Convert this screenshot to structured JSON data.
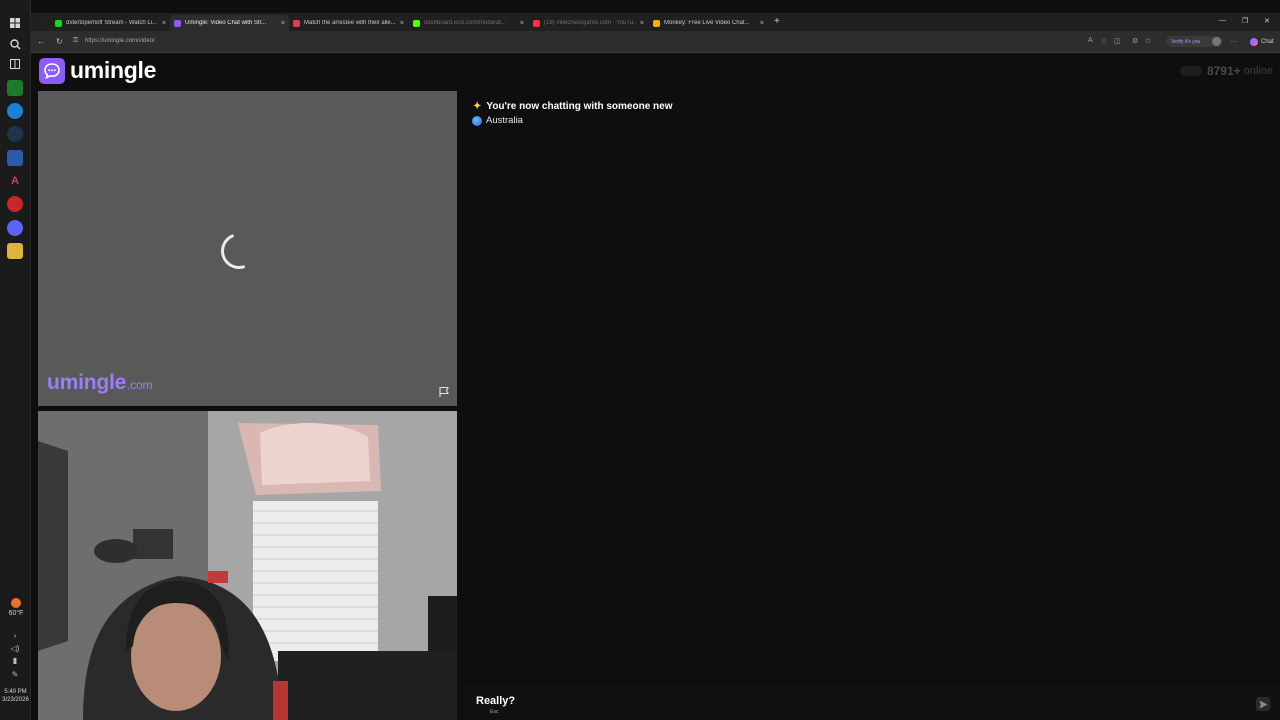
{
  "taskbar": {
    "weather": {
      "temp": "60°F"
    },
    "clock": {
      "time": "5:40 PM",
      "date": "3/23/2026"
    }
  },
  "browser": {
    "tabs": [
      {
        "title": "dxtertopemoff Stream - Watch Li...",
        "fav": "#24d024"
      },
      {
        "title": "Umingle: Video Chat with Str...",
        "fav": "#8b5cf6"
      },
      {
        "title": "Match the arrestee with their alle...",
        "fav": "#d8404b"
      },
      {
        "title": "dashboard.kick.com/moderat...",
        "fav": "#53fc18"
      },
      {
        "title": "(18) intelcheckgame.com - YouTu...",
        "fav": "#ff3040"
      },
      {
        "title": "Monkey: Free Live Video Chat...",
        "fav": "#f2b01e"
      }
    ],
    "url": "https://umingle.com/video/",
    "verify_label": "Verify it's you",
    "chat_label": "Chat"
  },
  "site": {
    "logo_text": "umingle",
    "online_count": "8791+",
    "online_label": "online",
    "watermark_brand": "umingle",
    "watermark_domain": ".com"
  },
  "chat": {
    "system_message": "You're now chatting with someone new",
    "location": "Australia"
  },
  "input": {
    "confirm_label": "Really?",
    "confirm_hint": "Esc"
  },
  "colors": {
    "brand": "#8b5cf6",
    "page_bg": "#0e0e0e",
    "video_bg": "#595959"
  }
}
